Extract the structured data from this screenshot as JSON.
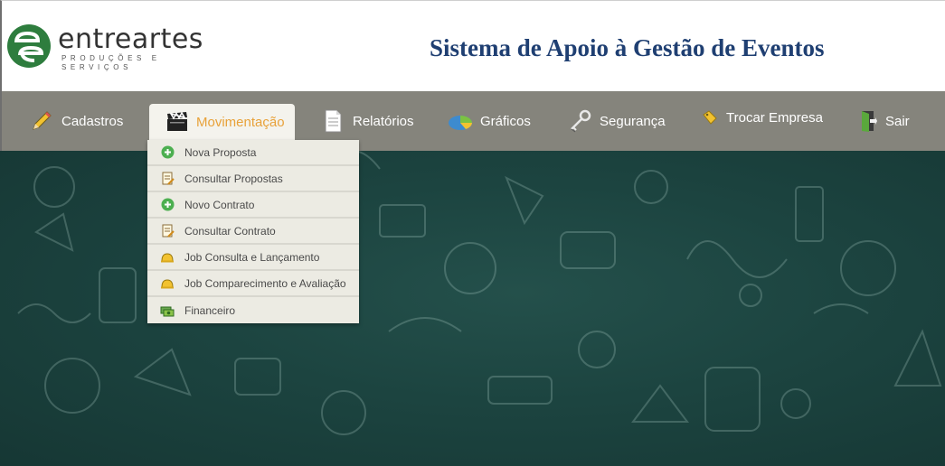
{
  "header": {
    "logo_word": "entreartes",
    "logo_tagline": "PRODUÇÕES E SERVIÇOS",
    "system_title": "Sistema de Apoio à Gestão de Eventos"
  },
  "nav": {
    "cadastros": "Cadastros",
    "movimentacao": "Movimentação",
    "relatorios": "Relatórios",
    "graficos": "Gráficos",
    "seguranca": "Segurança",
    "trocar_empresa": "Trocar Empresa",
    "sair": "Sair"
  },
  "dropdown": {
    "items": [
      {
        "label": "Nova Proposta",
        "icon": "add-circle-icon"
      },
      {
        "label": "Consultar Propostas",
        "icon": "document-pen-icon"
      },
      {
        "label": "Novo Contrato",
        "icon": "add-circle-icon"
      },
      {
        "label": "Consultar Contrato",
        "icon": "document-pen-icon"
      },
      {
        "label": "Job Consulta e Lançamento",
        "icon": "hardhat-icon"
      },
      {
        "label": "Job Comparecimento e Avaliação",
        "icon": "hardhat-icon"
      },
      {
        "label": "Financeiro",
        "icon": "money-icon"
      }
    ]
  },
  "colors": {
    "title": "#1f3f72",
    "navbar": "#85847c",
    "active_tab_text": "#e8a23a",
    "logo_green": "#2e7d3e",
    "background": "#1c4440"
  }
}
